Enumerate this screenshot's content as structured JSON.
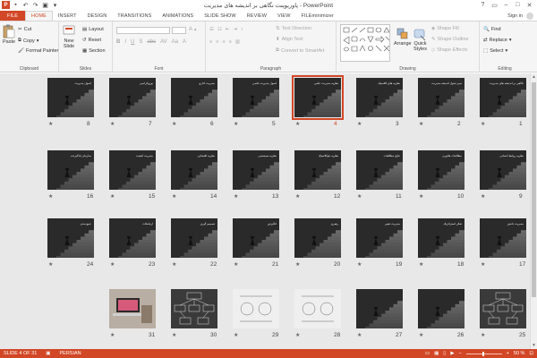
{
  "window": {
    "title": "پاورپوینت نگاهی بر اندیشه های مدیریت - PowerPoint",
    "sign_in": "Sign in",
    "controls": [
      "?",
      "▭",
      "–",
      "□",
      "✕"
    ]
  },
  "quick_access": [
    "P",
    "💾",
    "↶",
    "↷",
    "▣",
    "▾"
  ],
  "tabs": [
    "FILE",
    "HOME",
    "INSERT",
    "DESIGN",
    "TRANSITIONS",
    "ANIMATIONS",
    "SLIDE SHOW",
    "REVIEW",
    "VIEW",
    "FILEminimizer"
  ],
  "active_tab": "HOME",
  "ribbon": {
    "clipboard": {
      "label": "Clipboard",
      "paste": "Paste",
      "cut": "Cut",
      "copy": "Copy",
      "format_painter": "Format Painter"
    },
    "slides": {
      "label": "Slides",
      "new_slide": "New",
      "new_slide2": "Slide",
      "layout": "Layout",
      "reset": "Reset",
      "section": "Section"
    },
    "font": {
      "label": "Font"
    },
    "paragraph": {
      "label": "Paragraph",
      "text_direction": "Text Direction",
      "align_text": "Align Text",
      "convert_smartart": "Convert to SmartArt"
    },
    "drawing": {
      "label": "Drawing",
      "arrange": "Arrange",
      "quick_styles": "Quick",
      "quick_styles2": "Styles",
      "shape_fill": "Shape Fill",
      "shape_outline": "Shape Outline",
      "shape_effects": "Shape Effects"
    },
    "editing": {
      "label": "Editing",
      "find": "Find",
      "replace": "Replace",
      "select": "Select"
    }
  },
  "slides": [
    {
      "n": "1",
      "title": "نگاهی بر اندیشه های مدیریت",
      "style": "dark"
    },
    {
      "n": "2",
      "title": "سیر تحول اندیشه مدیریت",
      "style": "dark"
    },
    {
      "n": "3",
      "title": "نظریه های کلاسیک",
      "style": "dark"
    },
    {
      "n": "4",
      "title": "نظریه مدیریت علمی",
      "style": "dark"
    },
    {
      "n": "5",
      "title": "اصول مدیریت علمی",
      "style": "dark"
    },
    {
      "n": "6",
      "title": "مدیریت اداری",
      "style": "dark"
    },
    {
      "n": "7",
      "title": "بوروکراسی",
      "style": "dark"
    },
    {
      "n": "8",
      "title": "اصول مدیریت",
      "style": "dark"
    },
    {
      "n": "9",
      "title": "نظریه روابط انسانی",
      "style": "dark"
    },
    {
      "n": "10",
      "title": "مطالعات هاثورن",
      "style": "dark"
    },
    {
      "n": "11",
      "title": "نتایج مطالعات",
      "style": "dark"
    },
    {
      "n": "12",
      "title": "نظریه نئوکلاسیک",
      "style": "dark"
    },
    {
      "n": "13",
      "title": "نظریه سیستمی",
      "style": "dark"
    },
    {
      "n": "14",
      "title": "نظریه اقتضایی",
      "style": "dark"
    },
    {
      "n": "15",
      "title": "مدیریت کیفیت",
      "style": "dark"
    },
    {
      "n": "16",
      "title": "سازمان یادگیرنده",
      "style": "dark"
    },
    {
      "n": "17",
      "title": "مدیریت دانش",
      "style": "dark"
    },
    {
      "n": "18",
      "title": "تفکر استراتژیک",
      "style": "dark"
    },
    {
      "n": "19",
      "title": "مدیریت تغییر",
      "style": "dark"
    },
    {
      "n": "20",
      "title": "رهبری",
      "style": "dark"
    },
    {
      "n": "21",
      "title": "انگیزش",
      "style": "dark"
    },
    {
      "n": "22",
      "title": "تصمیم گیری",
      "style": "dark"
    },
    {
      "n": "23",
      "title": "ارتباطات",
      "style": "dark"
    },
    {
      "n": "24",
      "title": "جمع بندی",
      "style": "dark"
    },
    {
      "n": "25",
      "title": "",
      "style": "diagram"
    },
    {
      "n": "26",
      "title": "",
      "style": "dark"
    },
    {
      "n": "27",
      "title": "",
      "style": "dark"
    },
    {
      "n": "28",
      "title": "",
      "style": "light"
    },
    {
      "n": "29",
      "title": "",
      "style": "light"
    },
    {
      "n": "30",
      "title": "",
      "style": "diagram"
    },
    {
      "n": "31",
      "title": "",
      "style": "photo"
    }
  ],
  "selected_slide": "4",
  "status": {
    "slide_of": "SLIDE 4 OF 31",
    "language": "PERSIAN",
    "zoom": "50 %"
  },
  "colors": {
    "accent": "#d24726",
    "slide_bg": "#3a3a3a"
  }
}
